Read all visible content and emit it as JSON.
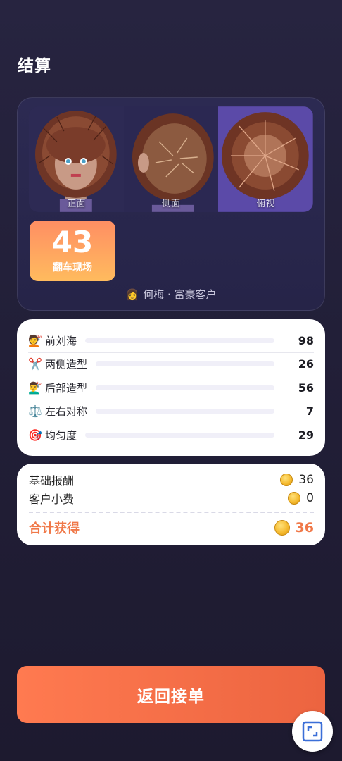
{
  "page": {
    "title": "结算"
  },
  "result": {
    "views": [
      {
        "label": "正面"
      },
      {
        "label": "侧面"
      },
      {
        "label": "俯视"
      }
    ],
    "score": "43",
    "rating": "翻车现场",
    "customer": {
      "emoji": "👩",
      "text": "何梅 · 富豪客户"
    }
  },
  "scores": [
    {
      "icon": "💇",
      "label": "前刘海",
      "value": "98"
    },
    {
      "icon": "✂️",
      "label": "两侧造型",
      "value": "26"
    },
    {
      "icon": "💇‍♂️",
      "label": "后部造型",
      "value": "56"
    },
    {
      "icon": "⚖️",
      "label": "左右对称",
      "value": "7"
    },
    {
      "icon": "🎯",
      "label": "均匀度",
      "value": "29"
    }
  ],
  "payment": {
    "base_label": "基础报酬",
    "base_value": "36",
    "tip_label": "客户小费",
    "tip_value": "0",
    "total_label": "合计获得",
    "total_value": "36"
  },
  "actions": {
    "return_label": "返回接单"
  },
  "colors": {
    "accent": "#f07848",
    "button": "#ef6b45",
    "card_dark": "#2a284e"
  }
}
